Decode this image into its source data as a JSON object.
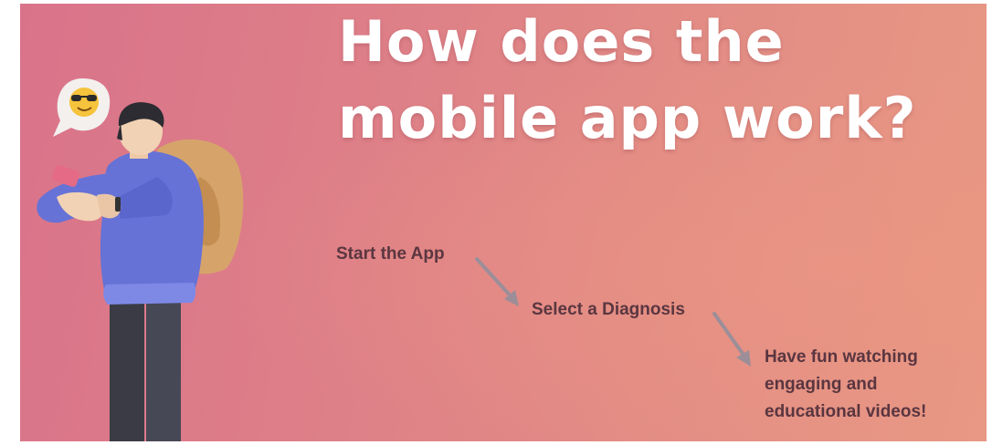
{
  "slide": {
    "title_line1": "How does the",
    "title_line2": "mobile app work?",
    "steps": [
      {
        "label": "Start the App"
      },
      {
        "label": "Select a Diagnosis"
      },
      {
        "label_lines": [
          "Have fun watching",
          "engaging and",
          "educational videos!"
        ]
      }
    ],
    "illustration": {
      "character": "person-with-backpack-holding-phone",
      "speech_bubble_icon": "sunglasses-emoji-icon"
    },
    "colors": {
      "background_left": "#d9738a",
      "background_right": "#e89884",
      "title_text": "#ffffff",
      "step_text": "#5a3640",
      "arrow": "#9b8e98"
    }
  }
}
